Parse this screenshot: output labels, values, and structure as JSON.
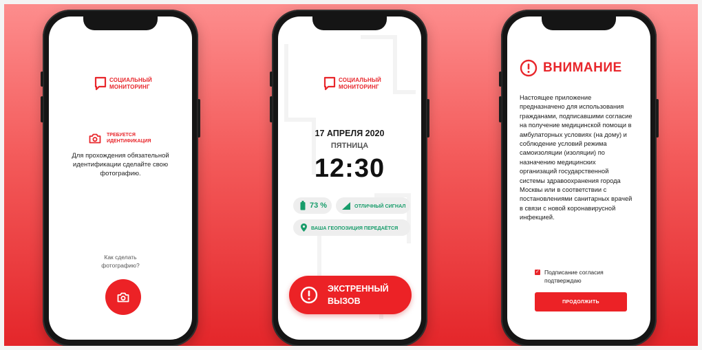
{
  "colors": {
    "accent": "#e8262b",
    "green": "#179c6a",
    "pill_bg": "#eeeeee"
  },
  "screen1": {
    "logo": {
      "line1": "СОЦИАЛЬНЫЙ",
      "line2": "МОНИТОРИНГ",
      "icon": "chat-bubble-icon"
    },
    "identification": {
      "line1": "ТРЕБУЕТСЯ",
      "line2": "ИДЕНТИФИКАЦИЯ",
      "icon": "camera-icon"
    },
    "description": [
      "Для прохождения обязательной",
      "идентификации сделайте свою",
      "фотографию."
    ],
    "how_to": [
      "Как сделать",
      "фотографию?"
    ],
    "camera_button_icon": "camera-icon"
  },
  "screen2": {
    "logo": {
      "line1": "СОЦИАЛЬНЫЙ",
      "line2": "МОНИТОРИНГ"
    },
    "date": "17 АПРЕЛЯ 2020",
    "weekday": "ПЯТНИЦА",
    "time": "12:30",
    "battery": "73 %",
    "signal": "ОТЛИЧНЫЙ СИГНАЛ",
    "geo": "ВАША ГЕОПОЗИЦИЯ ПЕРЕДАЁТСЯ",
    "emergency": {
      "line1": "ЭКСТРЕННЫЙ",
      "line2": "ВЫЗОВ",
      "icon": "alert-circle-icon"
    }
  },
  "screen3": {
    "title": "ВНИМАНИЕ",
    "notice": [
      "Настоящее приложение",
      "предназначено для использования",
      "гражданами, подписавшими согласие",
      "на получение медицинской помощи в",
      "амбулаторных условиях (на дому) и",
      "соблюдение условий режима",
      "самоизоляции (изоляции) по",
      "назначению медицинских",
      "организаций государственной",
      "системы здравоохранения города",
      "Москвы или в соответствии с",
      "постановлениями санитарных врачей",
      "в связи с новой коронавирусной",
      "инфекцией."
    ],
    "agree": [
      "Подписание согласия",
      "подтверждаю"
    ],
    "agree_checked": true,
    "continue_label": "ПРОДОЛЖИТЬ"
  }
}
